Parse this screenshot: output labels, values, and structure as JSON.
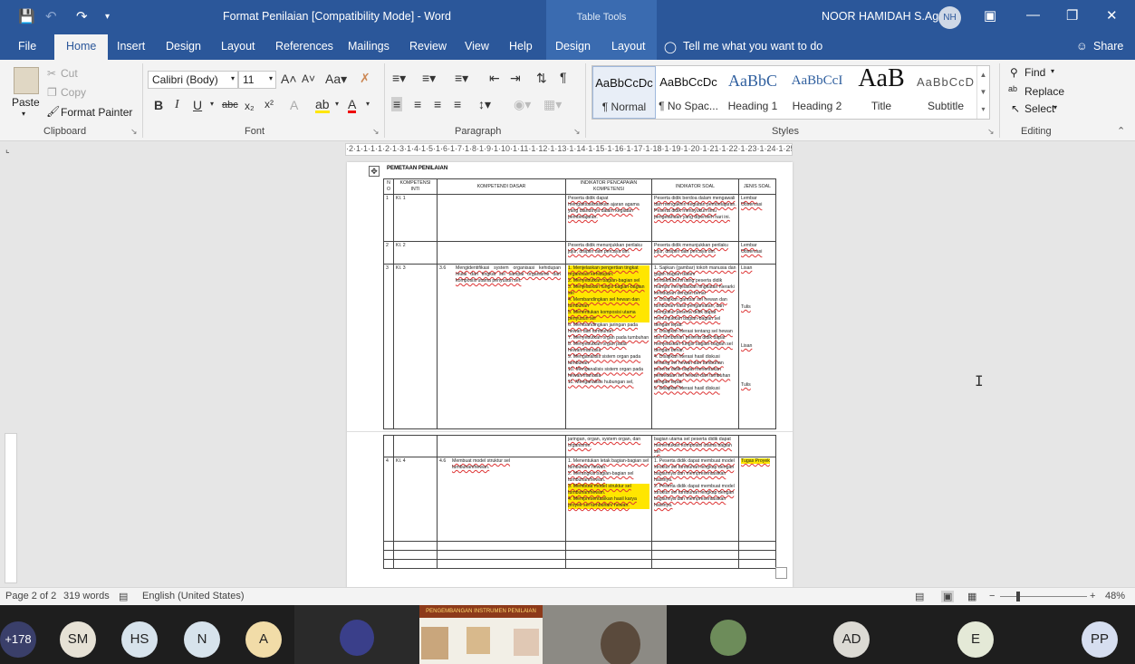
{
  "titlebar": {
    "title": "Format Penilaian [Compatibility Mode]  -  Word",
    "context_label": "Table Tools",
    "user_name": "NOOR HAMIDAH S.Ag",
    "user_initials": "NH",
    "save_icon": "save-icon",
    "undo_icon": "undo-icon",
    "redo_icon": "redo-icon"
  },
  "tabs": {
    "file": "File",
    "home": "Home",
    "insert": "Insert",
    "design": "Design",
    "layout": "Layout",
    "references": "References",
    "mailings": "Mailings",
    "review": "Review",
    "view": "View",
    "help": "Help",
    "table_design": "Design",
    "table_layout": "Layout",
    "tell_me": "Tell me what you want to do",
    "share": "Share"
  },
  "clipboard": {
    "paste": "Paste",
    "cut": "Cut",
    "copy": "Copy",
    "format_painter": "Format Painter",
    "label": "Clipboard"
  },
  "font": {
    "name": "Calibri (Body)",
    "size": "11",
    "label": "Font"
  },
  "paragraph": {
    "label": "Paragraph"
  },
  "styles": {
    "label": "Styles",
    "items": [
      {
        "preview": "AaBbCcDc",
        "name": "¶ Normal"
      },
      {
        "preview": "AaBbCcDc",
        "name": "¶ No Spac..."
      },
      {
        "preview": "AaBbC",
        "name": "Heading 1"
      },
      {
        "preview": "AaBbCcI",
        "name": "Heading 2"
      },
      {
        "preview": "AaB",
        "name": "Title"
      },
      {
        "preview": "AaBbCcD",
        "name": "Subtitle"
      }
    ]
  },
  "editing": {
    "find": "Find",
    "replace": "Replace",
    "select": "Select",
    "label": "Editing"
  },
  "ruler": {
    "text": "·2·1·1·1·1·2·1·3·1·4·1·5·1·6·1·7·1·8·1·9·1·10·1·11·1·12·1·13·1·14·1·15·1·16·1·17·1·18·1·19·1·20·1·21·1·22·1·23·1·24·1·25"
  },
  "document": {
    "heading": "PEMETAAN PENILAIAN",
    "headers": {
      "no": "N O",
      "ki": "KOMPETENSI INTI",
      "kd": "KOMPETENDI DASAR",
      "ipk": "INDIKATOR PENCAPAIAN KOMPETENSI",
      "soal": "INDIKATOR SOAL",
      "jenis": "JENIS SOAL"
    },
    "row1": {
      "no": "1",
      "ki": "KI. 1",
      "ipk": "Peserta didik dapat mengaktualisasikan ajaran agama yang dianutnya dalam kegiatan pembelajaran.",
      "soal": "Peserta didik berdoa dalam mengawali dan mengakhiri kegiatan pembelajaran. Peserta didik mensyukuri ilmu pengetahuan yang diperoleh hari ini.",
      "jenis": "Lembar Observasi"
    },
    "row2": {
      "no": "2",
      "ki": "KI. 2",
      "ipk": "Peserta didik menunjukkan perilaku jujur, disiplin dan percaya diri.",
      "soal": "Peserta didik menunjukkan perilaku jujur, disiplin dan percaya diri.",
      "jenis": "Lembar Observasi"
    },
    "row3": {
      "no": "3",
      "ki": "KI. 3",
      "kd_num": "3.6",
      "kd": "Mengidentifikasi system organisasi kehidupan mulai dari tingkat sel sampai organisme dan komposisi utama penyusun sel.",
      "ipk": [
        "1. Menjelaskan pengertian tingkat organisasi kehidupan.",
        "2. Menyebutkan bagian-bagian sel",
        "3. Menjelaskan fungsi bagian-bagian sel",
        "4. Membandingkan sel hewan dan tumbuhan",
        "5. Menentukan komposisi utama penyusun sel",
        "6. Membandingkan jaringan pada hewan dan tumbuhan",
        "7. Menyebutkan organ pada tumbuhan",
        "8. Menyebutkan organ pada hewan/manusia",
        "9. Menganalisis sistem organ pada tumbuhan",
        "10. Menganalisis sistem organ pada hewan/manusia",
        "11. Menganalisis hubungan sel,"
      ],
      "soal": [
        "1. Sajikan (gambar) tokoh manusia dan gajah bagian dalam kontak/tubuh/ruang peserta didik mampu menjelaskan tingkatan hierarki kehidupan dengan benar",
        "2. Disajikan gambar sel hewan dan tumbuhan hasil pengamatan, dan mengukur peserta didik dapat menunjukkan bagian-bagian sel dengan tepat.",
        "3. Disajikan literasi tentang sel hewan dan tumbuhan peserta didik dapat menjelaskan fungsi bagian-bagian sel dengan benar.",
        "4. Disajikan literasi hasil diskusi tentang sel hewan dan tumbuhan peserta didik dapat menentukan perbedaan sel hewan dan tumbuhan dengan tepat.",
        "5. Disajikan literasi hasil diskusi"
      ],
      "jenis": [
        "Lisan",
        "Tulis",
        "Lisan",
        "Tulis"
      ]
    },
    "row3b": {
      "ipk": "jaringan, organ, system organ, dan organisme.",
      "soal": "bagian utama sel peserta didik dapat menentukan komposisi utama bagian sel"
    },
    "row4": {
      "no": "4",
      "ki": "KI. 4",
      "kd_num": "4.6",
      "kd": "Membuat model struktur sel tumbuhan/hewan.",
      "ipk": [
        "1. Menentukan letak bagian-bagian sel tumbuhan/ hewan.",
        "2. Merangkai bagian-bagian sel tumbuhan/hewan.",
        "3. Membuat model struktur sel tumbuhan/hewan.",
        "4. Mempresentasikan hasil karya proyek sel tumbuhan/ hewan."
      ],
      "soal": [
        "1. Peserta didik dapat membuat model struktur sel tumbuhan lengkap dengan bagiannya dan mempresentasikan hasilnya.",
        "2. Peserta didik dapat membuat model struktur sel tumbuhan lengkap dengan bagiannya dan mempresentasikan hasilnya."
      ],
      "jenis": "Tugas Proyek"
    }
  },
  "statusbar": {
    "page": "Page 2 of 2",
    "words": "319 words",
    "language": "English (United States)",
    "zoom": "48%",
    "zoom_value": 0.48
  },
  "meeting": {
    "more_count": "+178",
    "participants": [
      "SM",
      "HS",
      "N",
      "A",
      "AD",
      "E",
      "PP"
    ],
    "shared_title": "PENGEMBANGAN INSTRUMEN PENILAIAN"
  }
}
